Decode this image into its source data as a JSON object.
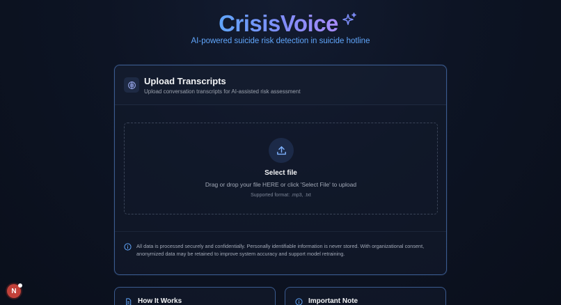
{
  "brand": {
    "title": "CrisisVoice",
    "icon": "sparkles-icon",
    "subtitle": "AI-powered suicide risk detection in suicide hotline"
  },
  "upload_card": {
    "icon": "brain-icon",
    "title": "Upload Transcripts",
    "description": "Upload conversation transcripts for AI-assisted risk assessment",
    "dropzone": {
      "icon": "upload-icon",
      "select_label": "Select file",
      "instructions": "Drag or drop your file HERE or click 'Select File' to upload",
      "formats": "Supported format: .mp3, .txt"
    },
    "notice": {
      "icon": "info-icon",
      "text": "All data is processed securely and confidentially. Personally identifiable information is never stored. With organizational consent, anonymized data may be retained to improve system accuracy and support model retraining."
    }
  },
  "info_cards": [
    {
      "icon": "document-icon",
      "title": "How It Works"
    },
    {
      "icon": "info-icon",
      "title": "Important Note"
    }
  ],
  "avatar": {
    "initial": "N"
  },
  "colors": {
    "accent": "#60a5fa",
    "accent_secondary": "#a78bfa",
    "border": "#3b5b8f",
    "background": "#0d1424"
  }
}
